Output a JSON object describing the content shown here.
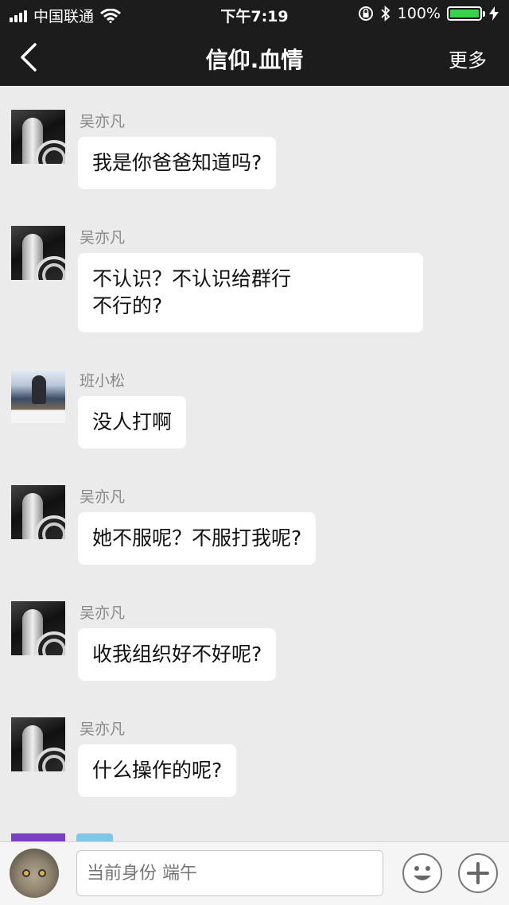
{
  "status_bar": {
    "carrier": "中国联通",
    "time": "下午7:19",
    "battery_percent": "100%",
    "battery_level": 1.0,
    "icons": [
      "signal-icon",
      "wifi-icon",
      "rotation-lock-icon",
      "bluetooth-icon",
      "battery-icon",
      "charging-icon"
    ]
  },
  "nav_bar": {
    "back_icon": "chevron-left-icon",
    "title": "信仰.血情",
    "more_label": "更多"
  },
  "messages": [
    {
      "sender": "吴亦凡",
      "lines": [
        "我是你爸爸知道吗?"
      ]
    },
    {
      "sender": "吴亦凡",
      "lines": [
        "不认识？不认识给群行",
        "不行的?"
      ]
    },
    {
      "sender": "班小松",
      "lines": [
        "没人打啊"
      ]
    },
    {
      "sender": "吴亦凡",
      "lines": [
        "她不服呢？不服打我呢?"
      ]
    },
    {
      "sender": "吴亦凡",
      "lines": [
        "收我组织好不好呢?"
      ]
    },
    {
      "sender": "吴亦凡",
      "lines": [
        "什么操作的呢?"
      ]
    }
  ],
  "input_bar": {
    "placeholder": "当前身份 端午",
    "emoji_icon": "emoji-icon",
    "plus_icon": "plus-icon"
  }
}
